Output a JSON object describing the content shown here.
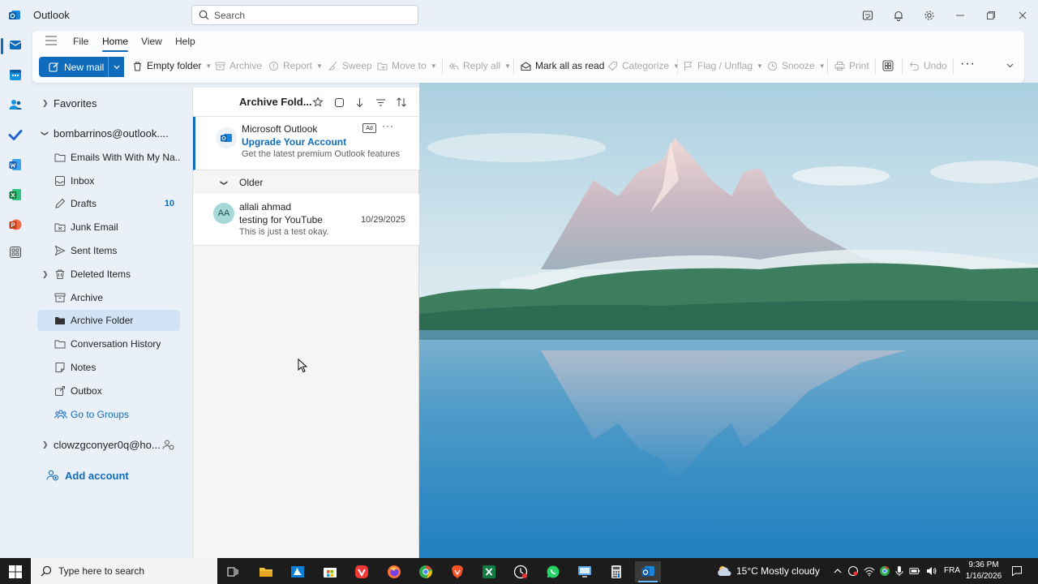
{
  "app": {
    "title": "Outlook"
  },
  "search": {
    "placeholder": "Search"
  },
  "menu": {
    "tabs": [
      {
        "label": "File",
        "active": false
      },
      {
        "label": "Home",
        "active": true
      },
      {
        "label": "View",
        "active": false
      },
      {
        "label": "Help",
        "active": false
      }
    ]
  },
  "ribbon": {
    "new_mail": "New mail",
    "empty_folder": "Empty folder",
    "archive": "Archive",
    "report": "Report",
    "sweep": "Sweep",
    "move_to": "Move to",
    "reply_all": "Reply all",
    "mark_all_read": "Mark all as read",
    "categorize": "Categorize",
    "flag": "Flag / Unflag",
    "snooze": "Snooze",
    "print": "Print",
    "undo": "Undo"
  },
  "folders": {
    "favorites": "Favorites",
    "account1": "bombarrinos@outlook....",
    "items": [
      {
        "label": "Emails With With My Na...",
        "count": ""
      },
      {
        "label": "Inbox",
        "count": ""
      },
      {
        "label": "Drafts",
        "count": "10"
      },
      {
        "label": "Junk Email",
        "count": ""
      },
      {
        "label": "Sent Items",
        "count": ""
      },
      {
        "label": "Deleted Items",
        "count": ""
      },
      {
        "label": "Archive",
        "count": ""
      },
      {
        "label": "Archive Folder",
        "count": ""
      },
      {
        "label": "Conversation History",
        "count": ""
      },
      {
        "label": "Notes",
        "count": ""
      },
      {
        "label": "Outbox",
        "count": ""
      },
      {
        "label": "Go to Groups",
        "count": ""
      }
    ],
    "account2": "clowzgconyer0q@ho...",
    "add_account": "Add account"
  },
  "message_list": {
    "title": "Archive Fold...",
    "ad": {
      "sender": "Microsoft Outlook",
      "subject": "Upgrade Your Account",
      "preview": "Get the latest premium Outlook features",
      "badge": "Ad"
    },
    "group": "Older",
    "messages": [
      {
        "initials": "AA",
        "sender": "allali ahmad",
        "subject": "testing for YouTube",
        "preview": "This is just a test okay.",
        "date": "10/29/2025"
      }
    ]
  },
  "taskbar": {
    "search_placeholder": "Type here to search",
    "weather": "15°C  Mostly cloudy",
    "language": "FRA",
    "time": "9:36 PM",
    "date": "1/16/2026"
  },
  "colors": {
    "accent": "#0f6cbd",
    "pane_bg": "#eaf0f7",
    "taskbar": "#1c1c1c"
  }
}
